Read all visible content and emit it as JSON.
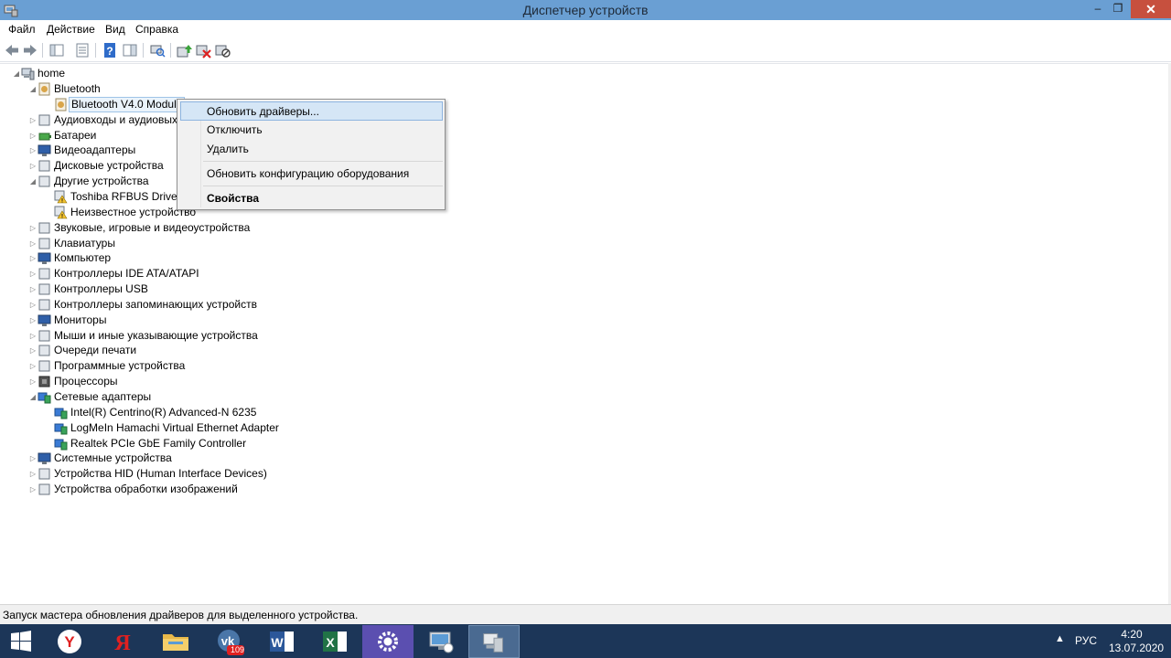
{
  "window": {
    "title": "Диспетчер устройств",
    "minimize": "–",
    "maximize": "❐",
    "close": "✕"
  },
  "menu": [
    "Файл",
    "Действие",
    "Вид",
    "Справка"
  ],
  "toolbar": {
    "buttons": [
      "back-icon",
      "forward-icon",
      "show-hide-console-tree-icon",
      "properties-icon",
      "help-icon",
      "action-pane-icon",
      "scan-hardware-icon",
      "update-driver-icon",
      "uninstall-icon",
      "disable-icon"
    ]
  },
  "tree": {
    "root": "home",
    "items": [
      {
        "label": "Bluetooth",
        "level": 1,
        "expanded": true,
        "icon": "bluetooth-category-icon"
      },
      {
        "label": "Bluetooth V4.0 Module",
        "level": 2,
        "selected": true,
        "icon": "bluetooth-device-icon"
      },
      {
        "label": "Аудиовходы и аудиовыходы",
        "level": 1,
        "expanded": false,
        "icon": "audio-icon"
      },
      {
        "label": "Батареи",
        "level": 1,
        "expanded": false,
        "icon": "battery-icon"
      },
      {
        "label": "Видеоадаптеры",
        "level": 1,
        "expanded": false,
        "icon": "display-adapter-icon"
      },
      {
        "label": "Дисковые устройства",
        "level": 1,
        "expanded": false,
        "icon": "disk-drive-icon"
      },
      {
        "label": "Другие устройства",
        "level": 1,
        "expanded": true,
        "icon": "other-devices-icon"
      },
      {
        "label": "Toshiba RFBUS Driver",
        "level": 2,
        "icon": "warning-device-icon"
      },
      {
        "label": "Неизвестное устройство",
        "level": 2,
        "icon": "warning-device-icon"
      },
      {
        "label": "Звуковые, игровые и видеоустройства",
        "level": 1,
        "expanded": false,
        "icon": "sound-icon"
      },
      {
        "label": "Клавиатуры",
        "level": 1,
        "expanded": false,
        "icon": "keyboard-icon"
      },
      {
        "label": "Компьютер",
        "level": 1,
        "expanded": false,
        "icon": "computer-icon"
      },
      {
        "label": "Контроллеры IDE ATA/ATAPI",
        "level": 1,
        "expanded": false,
        "icon": "ide-controller-icon"
      },
      {
        "label": "Контроллеры USB",
        "level": 1,
        "expanded": false,
        "icon": "usb-icon"
      },
      {
        "label": "Контроллеры запоминающих устройств",
        "level": 1,
        "expanded": false,
        "icon": "storage-controller-icon"
      },
      {
        "label": "Мониторы",
        "level": 1,
        "expanded": false,
        "icon": "monitor-icon"
      },
      {
        "label": "Мыши и иные указывающие устройства",
        "level": 1,
        "expanded": false,
        "icon": "mouse-icon"
      },
      {
        "label": "Очереди печати",
        "level": 1,
        "expanded": false,
        "icon": "printer-icon"
      },
      {
        "label": "Программные устройства",
        "level": 1,
        "expanded": false,
        "icon": "software-device-icon"
      },
      {
        "label": "Процессоры",
        "level": 1,
        "expanded": false,
        "icon": "processor-icon"
      },
      {
        "label": "Сетевые адаптеры",
        "level": 1,
        "expanded": true,
        "icon": "network-adapter-icon"
      },
      {
        "label": "Intel(R) Centrino(R) Advanced-N 6235",
        "level": 2,
        "icon": "network-adapter-icon"
      },
      {
        "label": "LogMeIn Hamachi Virtual Ethernet Adapter",
        "level": 2,
        "icon": "network-adapter-icon"
      },
      {
        "label": "Realtek PCIe GbE Family Controller",
        "level": 2,
        "icon": "network-adapter-icon"
      },
      {
        "label": "Системные устройства",
        "level": 1,
        "expanded": false,
        "icon": "system-device-icon"
      },
      {
        "label": "Устройства HID (Human Interface Devices)",
        "level": 1,
        "expanded": false,
        "icon": "hid-icon"
      },
      {
        "label": "Устройства обработки изображений",
        "level": 1,
        "expanded": false,
        "icon": "imaging-device-icon"
      }
    ]
  },
  "context_menu": {
    "items": [
      "Обновить драйверы...",
      "Отключить",
      "Удалить",
      "Обновить конфигурацию оборудования",
      "Свойства"
    ],
    "highlighted": "Обновить драйверы...",
    "default": "Свойства"
  },
  "statusbar": {
    "text": "Запуск мастера обновления драйверов для выделенного устройства."
  },
  "taskbar": {
    "apps": [
      "start-icon",
      "yandex-browser-icon",
      "yandex-icon",
      "file-explorer-icon",
      "vk-icon",
      "word-icon",
      "excel-icon",
      "settings-icon",
      "remote-desktop-icon",
      "device-manager-icon"
    ],
    "vk_badge": "109",
    "language": "РУС",
    "time": "4:20",
    "date": "13.07.2020"
  },
  "colors": {
    "titlebar": "#6a9fd3",
    "close_button": "#c7503e",
    "taskbar": "#1c3658",
    "menu_highlight": "#d5e6f6"
  }
}
